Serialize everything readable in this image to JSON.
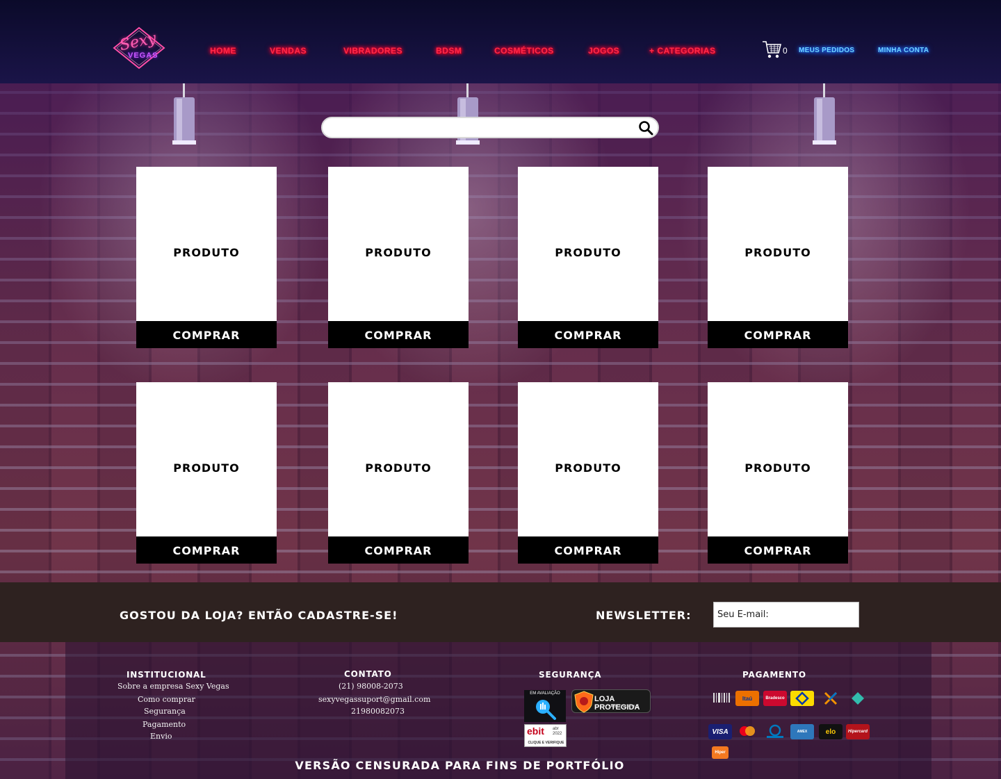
{
  "header": {
    "logo_line1": "Sexy",
    "logo_line2": "VEGAS",
    "nav": [
      "HOME",
      "VENDAS",
      "VIBRADORES",
      "BDSM",
      "COSMÉTICOS",
      "JOGOS",
      "+ CATEGORIAS"
    ],
    "cart_count": "0",
    "my_orders": "MEUS PEDIDOS",
    "my_account": "MINHA CONTA"
  },
  "search": {
    "placeholder": ""
  },
  "products": [
    {
      "label": "PRODUTO",
      "button": "COMPRAR"
    },
    {
      "label": "PRODUTO",
      "button": "COMPRAR"
    },
    {
      "label": "PRODUTO",
      "button": "COMPRAR"
    },
    {
      "label": "PRODUTO",
      "button": "COMPRAR"
    },
    {
      "label": "PRODUTO",
      "button": "COMPRAR"
    },
    {
      "label": "PRODUTO",
      "button": "COMPRAR"
    },
    {
      "label": "PRODUTO",
      "button": "COMPRAR"
    },
    {
      "label": "PRODUTO",
      "button": "COMPRAR"
    }
  ],
  "newsletter": {
    "cta": "GOSTOU DA LOJA? ENTÃO CADASTRE-SE!",
    "label": "NEWSLETTER:",
    "placeholder": "Seu E-mail:"
  },
  "footer": {
    "institucional": {
      "title": "INSTITUCIONAL",
      "links": [
        "Sobre a empresa Sexy Vegas",
        "Como comprar",
        "Segurança",
        "Pagamento",
        "Envio"
      ]
    },
    "contato": {
      "title": "CONTATO",
      "lines": [
        "(21) 98008-2073",
        "sexyvegassuport@gmail.com",
        "21980082073"
      ]
    },
    "seguranca": {
      "title": "SEGURANÇA",
      "badge_review": "EM AVALIAÇÃO",
      "badge_protected": "LOJA PROTEGIDA",
      "badge_protected_sub": "SAIBA O POR QUÊ",
      "badge_ebit": "ebit",
      "badge_ebit_date": "abr 2022",
      "badge_ebit_cta": "CLIQUE E VERIFIQUE"
    },
    "pagamento": {
      "title": "PAGAMENTO",
      "methods": [
        "Boleto",
        "Itaú",
        "Bradesco",
        "BB",
        "Pix",
        "Pix",
        "VISA",
        "Mastercard",
        "Diners",
        "AMEX",
        "elo",
        "Hipercard",
        "Hiper"
      ]
    },
    "note": "VERSÃO CENSURADA PARA FINS DE PORTFÓLIO"
  },
  "colors": {
    "nav_red": "#ff2a4a",
    "nav_blue": "#6fd2ff",
    "header_bg": "#0b0a2a",
    "newsletter_bg": "#2e2220",
    "button_bg": "#000000"
  }
}
